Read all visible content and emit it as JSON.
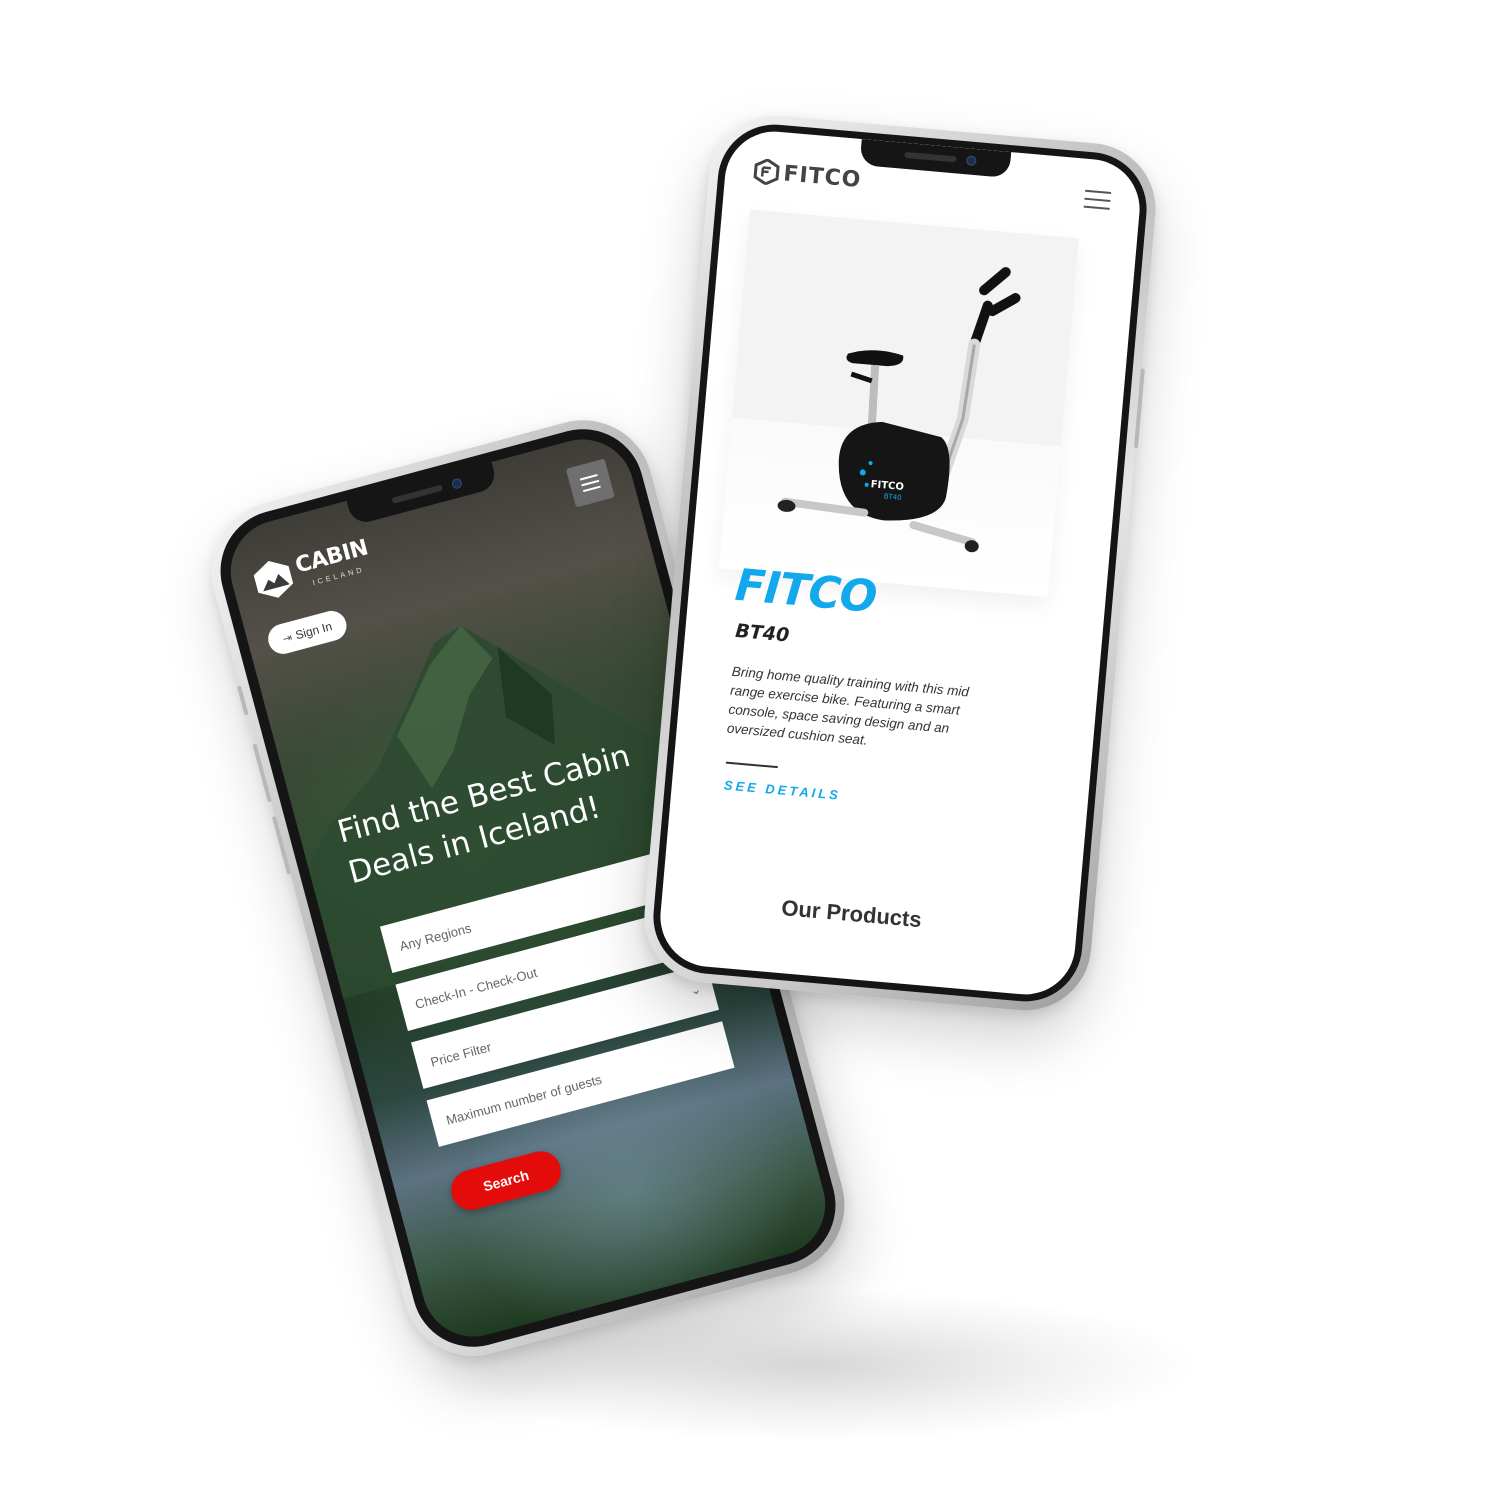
{
  "cabin_app": {
    "logo": {
      "name": "CABIN",
      "subtitle": "ICELAND"
    },
    "signin_label": "Sign In",
    "hero_title": "Find the Best Cabin Deals in Iceland!",
    "fields": {
      "region": "Any Regions",
      "dates": "Check-In - Check-Out",
      "price": "Price Filter",
      "guests": "Maximum number of guests"
    },
    "search_label": "Search",
    "accent": "#e40b0b"
  },
  "fitco_app": {
    "logo": "FITCO",
    "brand": "FITCO",
    "model": "BT40",
    "description": "Bring home quality training with this mid range exercise bike. Featuring a smart console, space saving design and an oversized cushion seat.",
    "cta": "SEE DETAILS",
    "section_title": "Our Products",
    "bike_label": "FITCO",
    "bike_model_label": "BT40",
    "accent": "#11a8ec"
  }
}
